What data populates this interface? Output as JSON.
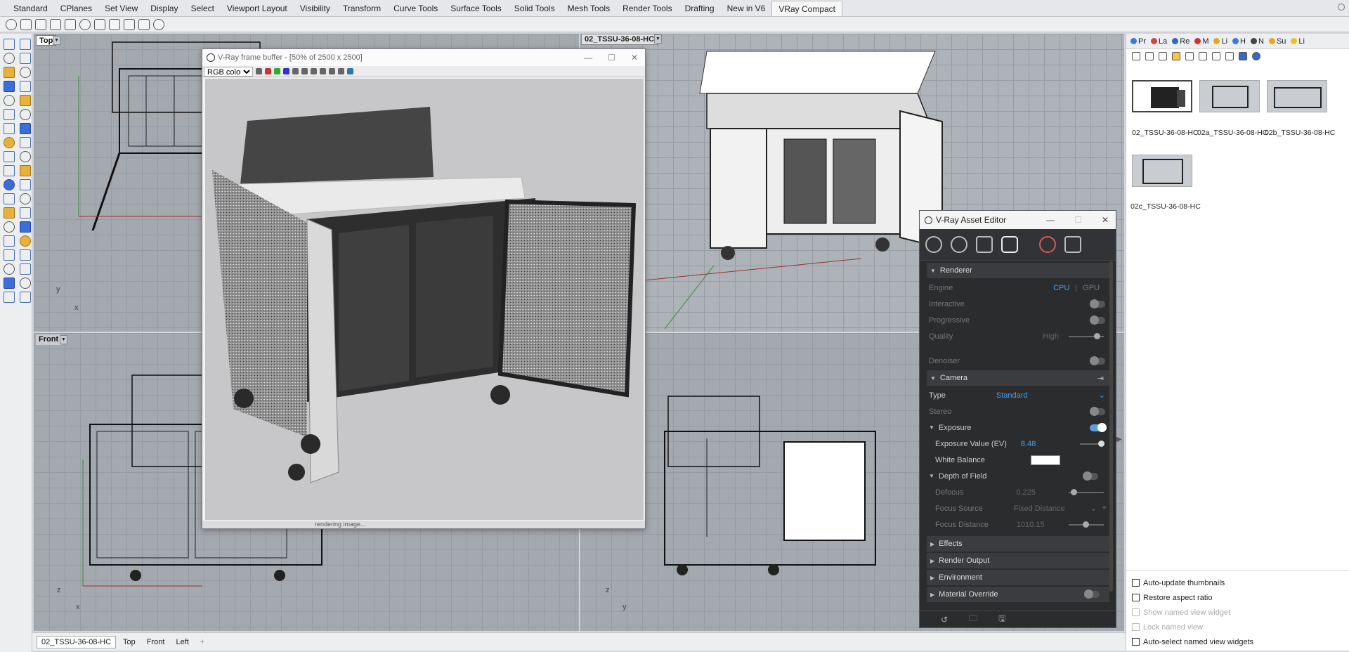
{
  "ribbon_tabs": [
    "Standard",
    "CPlanes",
    "Set View",
    "Display",
    "Select",
    "Viewport Layout",
    "Visibility",
    "Transform",
    "Curve Tools",
    "Surface Tools",
    "Solid Tools",
    "Mesh Tools",
    "Render Tools",
    "Drafting",
    "New in V6",
    "VRay Compact"
  ],
  "active_ribbon_tab": "VRay Compact",
  "viewports": {
    "top": {
      "label": "Top",
      "axis_y": "y",
      "axis_x": "x"
    },
    "perspective": {
      "label": "02_TSSU-36-08-HC"
    },
    "front": {
      "label": "Front",
      "axis_z": "z",
      "axis_x": "x"
    },
    "right": {
      "axis_z": "z",
      "axis_y": "y"
    }
  },
  "frame_buffer": {
    "title": "V-Ray frame buffer - [50% of 2500 x 2500]",
    "channel": "RGB color",
    "status": "rendering image..."
  },
  "asset_editor": {
    "title": "V-Ray Asset Editor",
    "renderer": {
      "label": "Renderer",
      "engine_label": "Engine",
      "engine_cpu": "CPU",
      "engine_sep": "|",
      "engine_gpu": "GPU",
      "interactive_label": "Interactive",
      "progressive_label": "Progressive",
      "quality_label": "Quality",
      "quality_value": "High",
      "denoiser_label": "Denoiser"
    },
    "camera": {
      "label": "Camera",
      "type_label": "Type",
      "type_value": "Standard",
      "stereo_label": "Stereo"
    },
    "exposure": {
      "label": "Exposure",
      "ev_label": "Exposure Value (EV)",
      "ev_value": "8.48",
      "wb_label": "White Balance",
      "white_balance_color": "#ffffff"
    },
    "dof": {
      "label": "Depth of Field",
      "defocus_label": "Defocus",
      "defocus_value": "0.225",
      "focus_source_label": "Focus Source",
      "focus_source_value": "Fixed Distance",
      "focus_distance_label": "Focus Distance",
      "focus_distance_value": "1010.15"
    },
    "sections": [
      "Effects",
      "Render Output",
      "Environment",
      "Material Override"
    ]
  },
  "right_panel": {
    "tabs": [
      "Pr",
      "La",
      "Re",
      "M",
      "Li",
      "H",
      "N",
      "Su",
      "Li"
    ],
    "views": [
      "02_TSSU-36-08-HC",
      "02a_TSSU-36-08-HC",
      "02b_TSSU-36-08-HC",
      "02c_TSSU-36-08-HC"
    ],
    "options": [
      "Auto-update thumbnails",
      "Restore aspect ratio",
      "Show named view widget",
      "Lock named view",
      "Auto-select named view widgets"
    ]
  },
  "bottom_tabs": [
    "02_TSSU-36-08-HC",
    "Top",
    "Front",
    "Left"
  ],
  "bottom_add": "+",
  "colors": {
    "accent": "#4aa0e8",
    "dark_panel": "#2b2c2e"
  }
}
